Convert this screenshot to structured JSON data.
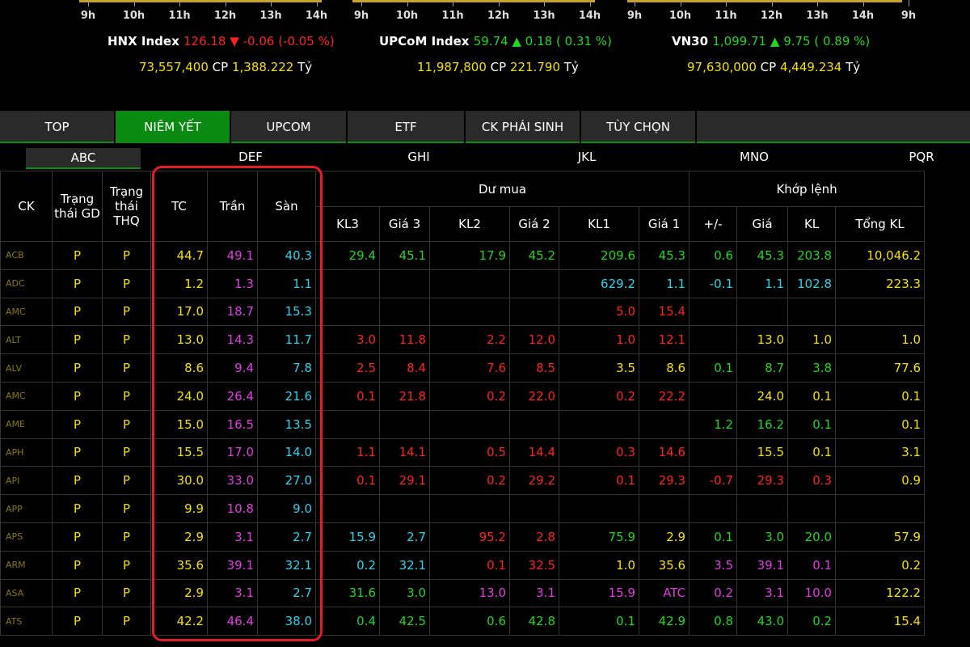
{
  "time_axes": [
    [
      "9h",
      "10h",
      "11h",
      "12h",
      "13h",
      "14h"
    ],
    [
      "9h",
      "10h",
      "11h",
      "12h",
      "13h",
      "14h"
    ],
    [
      "9h",
      "10h",
      "11h",
      "12h",
      "13h",
      "14h",
      "9h"
    ]
  ],
  "indices": [
    {
      "name": "HNX Index",
      "value": "126.18",
      "arrow": "▼",
      "change": "-0.06",
      "pct": "(-0.05 %)",
      "color": "#ff2020",
      "volume": "73,557,400",
      "cp": "CP",
      "amount": "1,388.222",
      "unit": "Tỷ"
    },
    {
      "name": "UPCoM Index",
      "value": "59.74",
      "arrow": "▲",
      "change": "0.18",
      "pct": "( 0.31 %)",
      "color": "#22d622",
      "volume": "11,987,800",
      "cp": "CP",
      "amount": "221.790",
      "unit": "Tỷ"
    },
    {
      "name": "VN30",
      "value": "1,099.71",
      "arrow": "▲",
      "change": "9.75",
      "pct": "( 0.89 %)",
      "color": "#22d622",
      "volume": "97,630,000",
      "cp": "CP",
      "amount": "4,449.234",
      "unit": "Tỷ"
    }
  ],
  "tabs": [
    "TOP",
    "NIÊM YẾT",
    "UPCOM",
    "ETF",
    "CK PHÁI SINH",
    "TÙY CHỌN"
  ],
  "active_tab": "NIÊM YẾT",
  "subtabs": [
    "ABC",
    "DEF",
    "GHI",
    "JKL",
    "MNO",
    "PQR"
  ],
  "headers": {
    "ck": "CK",
    "tt_gd": "Trạng thái GD",
    "tt_thq": "Trạng thái THQ",
    "tc": "TC",
    "tran": "Trần",
    "san": "Sàn",
    "du_mua": "Dư mua",
    "khop_lenh": "Khớp lệnh",
    "kl3": "KL3",
    "gia3": "Giá 3",
    "kl2": "KL2",
    "gia2": "Giá 2",
    "kl1": "KL1",
    "gia1": "Giá 1",
    "change": "+/-",
    "gia": "Giá",
    "kl": "KL",
    "tong_kl": "Tổng KL"
  },
  "rows": [
    [
      "ACB",
      "P",
      "P",
      "44.7",
      "49.1",
      "40.3",
      "29.4",
      "45.1",
      "17.9",
      "45.2",
      "209.6",
      "45.3",
      "0.6",
      "45.3",
      "203.8",
      "10,046.2"
    ],
    [
      "ADC",
      "P",
      "P",
      "1.2",
      "1.3",
      "1.1",
      "",
      "",
      "",
      "",
      "629.2",
      "1.1",
      "-0.1",
      "1.1",
      "102.8",
      "223.3"
    ],
    [
      "AMC",
      "P",
      "P",
      "17.0",
      "18.7",
      "15.3",
      "",
      "",
      "",
      "",
      "5.0",
      "15.4",
      "",
      "",
      "",
      ""
    ],
    [
      "ALT",
      "P",
      "P",
      "13.0",
      "14.3",
      "11.7",
      "3.0",
      "11.8",
      "2.2",
      "12.0",
      "1.0",
      "12.1",
      "",
      "13.0",
      "1.0",
      "1.0"
    ],
    [
      "ALV",
      "P",
      "P",
      "8.6",
      "9.4",
      "7.8",
      "2.5",
      "8.4",
      "7.6",
      "8.5",
      "3.5",
      "8.6",
      "0.1",
      "8.7",
      "3.8",
      "77.6"
    ],
    [
      "AMC",
      "P",
      "P",
      "24.0",
      "26.4",
      "21.6",
      "0.1",
      "21.8",
      "0.2",
      "22.0",
      "0.2",
      "22.2",
      "",
      "24.0",
      "0.1",
      "0.1"
    ],
    [
      "AME",
      "P",
      "P",
      "15.0",
      "16.5",
      "13.5",
      "",
      "",
      "",
      "",
      "",
      "",
      "1.2",
      "16.2",
      "0.1",
      "0.1"
    ],
    [
      "APH",
      "P",
      "P",
      "15.5",
      "17.0",
      "14.0",
      "1.1",
      "14.1",
      "0.5",
      "14.4",
      "0.3",
      "14.6",
      "",
      "15.5",
      "0.1",
      "3.1"
    ],
    [
      "API",
      "P",
      "P",
      "30.0",
      "33.0",
      "27.0",
      "0.1",
      "29.1",
      "0.2",
      "29.2",
      "0.1",
      "29.3",
      "-0.7",
      "29.3",
      "0.3",
      "0.9"
    ],
    [
      "APP",
      "P",
      "P",
      "9.9",
      "10.8",
      "9.0",
      "",
      "",
      "",
      "",
      "",
      "",
      "",
      "",
      "",
      ""
    ],
    [
      "APS",
      "P",
      "P",
      "2.9",
      "3.1",
      "2.7",
      "15.9",
      "2.7",
      "95.2",
      "2.8",
      "75.9",
      "2.9",
      "0.1",
      "3.0",
      "20.0",
      "57.9"
    ],
    [
      "ARM",
      "P",
      "P",
      "35.6",
      "39.1",
      "32.1",
      "0.2",
      "32.1",
      "0.1",
      "32.5",
      "1.0",
      "35.6",
      "3.5",
      "39.1",
      "0.1",
      "0.2"
    ],
    [
      "ASA",
      "P",
      "P",
      "2.9",
      "3.1",
      "2.7",
      "31.6",
      "3.0",
      "13.0",
      "3.1",
      "15.9",
      "ATC",
      "0.2",
      "3.1",
      "10.0",
      "122.2"
    ],
    [
      "ATS",
      "P",
      "P",
      "42.2",
      "46.4",
      "38.0",
      "0.4",
      "42.5",
      "0.6",
      "42.8",
      "0.1",
      "42.9",
      "0.8",
      "43.0",
      "0.2",
      "15.4"
    ]
  ],
  "row_colors": [
    [
      "y",
      "y",
      "y",
      "y",
      "p",
      "c",
      "g",
      "g",
      "g",
      "g",
      "g",
      "g",
      "g",
      "g",
      "g",
      "y"
    ],
    [
      "y",
      "y",
      "y",
      "y",
      "p",
      "c",
      "w",
      "w",
      "w",
      "w",
      "c",
      "c",
      "c",
      "c",
      "c",
      "y"
    ],
    [
      "y",
      "y",
      "y",
      "y",
      "p",
      "c",
      "w",
      "w",
      "w",
      "w",
      "r",
      "r",
      "w",
      "w",
      "w",
      "w"
    ],
    [
      "y",
      "y",
      "y",
      "y",
      "p",
      "c",
      "r",
      "r",
      "r",
      "r",
      "r",
      "r",
      "y",
      "y",
      "y",
      "y"
    ],
    [
      "y",
      "y",
      "y",
      "y",
      "p",
      "c",
      "r",
      "r",
      "r",
      "r",
      "y",
      "y",
      "g",
      "g",
      "g",
      "y"
    ],
    [
      "y",
      "y",
      "y",
      "y",
      "p",
      "c",
      "r",
      "r",
      "r",
      "r",
      "r",
      "r",
      "y",
      "y",
      "y",
      "y"
    ],
    [
      "y",
      "y",
      "y",
      "y",
      "p",
      "c",
      "w",
      "w",
      "w",
      "w",
      "w",
      "w",
      "g",
      "g",
      "g",
      "y"
    ],
    [
      "y",
      "y",
      "y",
      "y",
      "p",
      "c",
      "r",
      "r",
      "r",
      "r",
      "r",
      "r",
      "y",
      "y",
      "y",
      "y"
    ],
    [
      "y",
      "y",
      "y",
      "y",
      "p",
      "c",
      "r",
      "r",
      "r",
      "r",
      "r",
      "r",
      "r",
      "r",
      "r",
      "y"
    ],
    [
      "y",
      "y",
      "y",
      "y",
      "p",
      "c",
      "w",
      "w",
      "w",
      "w",
      "w",
      "w",
      "w",
      "w",
      "w",
      "y"
    ],
    [
      "y",
      "y",
      "y",
      "y",
      "p",
      "c",
      "c",
      "c",
      "r",
      "r",
      "g",
      "y",
      "g",
      "g",
      "g",
      "y"
    ],
    [
      "y",
      "y",
      "y",
      "y",
      "p",
      "c",
      "c",
      "c",
      "r",
      "r",
      "y",
      "y",
      "p",
      "p",
      "p",
      "y"
    ],
    [
      "y",
      "y",
      "y",
      "y",
      "p",
      "c",
      "g",
      "g",
      "p",
      "p",
      "p",
      "p",
      "p",
      "p",
      "p",
      "y"
    ],
    [
      "y",
      "y",
      "y",
      "y",
      "p",
      "c",
      "g",
      "g",
      "g",
      "g",
      "g",
      "g",
      "g",
      "g",
      "g",
      "y"
    ]
  ]
}
